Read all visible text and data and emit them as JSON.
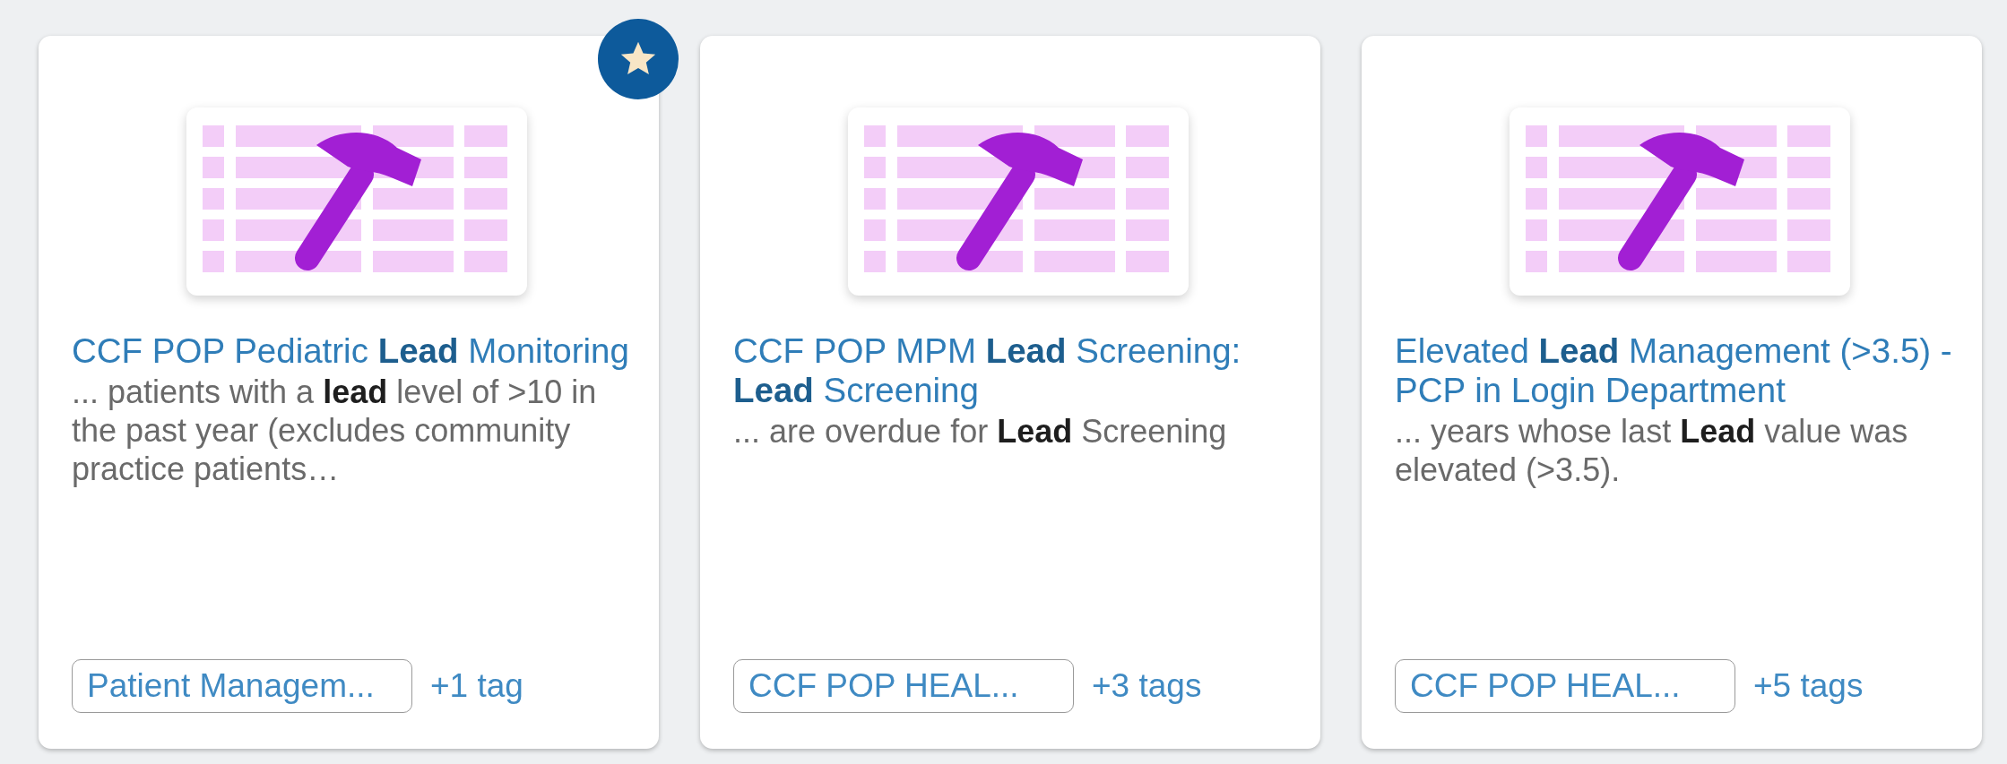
{
  "cards": [
    {
      "title": "CCF POP Pediatric **Lead** Monitoring",
      "description": "... patients with a **lead** level of >10 in the past year (excludes community practice patients…",
      "tag": "Patient Managem...",
      "more_tags": "+1 tag",
      "starred": true
    },
    {
      "title": "CCF POP MPM **Lead** Screening: **Lead** Screening",
      "description": "... are overdue for **Lead** Screening",
      "tag": "CCF POP HEAL...",
      "more_tags": "+3 tags",
      "starred": false
    },
    {
      "title": "Elevated **Lead** Management (>3.5) - PCP in Login Department",
      "description": "... years whose last **Lead** value was elevated (>3.5).",
      "tag": "CCF POP HEAL...",
      "more_tags": "+5 tags",
      "starred": false
    }
  ]
}
